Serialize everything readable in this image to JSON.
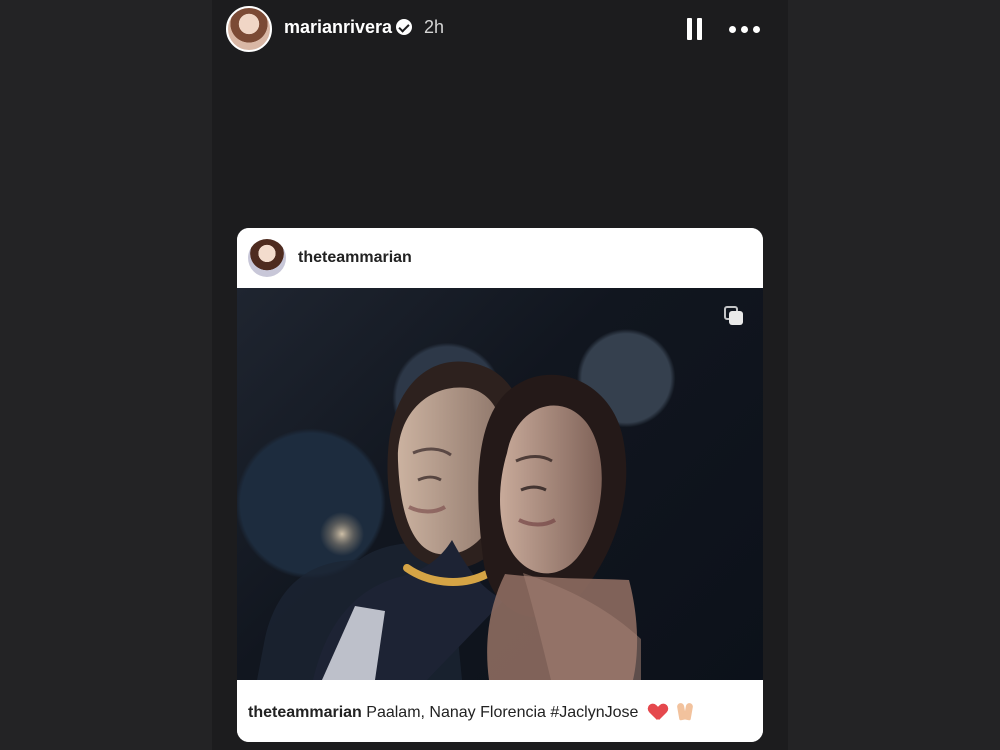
{
  "header": {
    "username": "marianrivera",
    "time": "2h",
    "verified_icon": "verified-badge-icon",
    "avatar_icon": "profile-avatar",
    "actions": [
      {
        "name": "pause-button",
        "icon": "pause-icon"
      },
      {
        "name": "more-options-button",
        "icon": "more-icon"
      }
    ]
  },
  "shared_post": {
    "username": "theteammarian",
    "avatar_icon": "profile-avatar",
    "carousel_icon": "carousel-icon",
    "caption": {
      "username": "theteammarian",
      "text": "Paalam, Nanay Florencia #JaclynJose",
      "emoji": [
        "heart-icon",
        "pray-icon"
      ]
    },
    "photo_description_label": "photo"
  }
}
